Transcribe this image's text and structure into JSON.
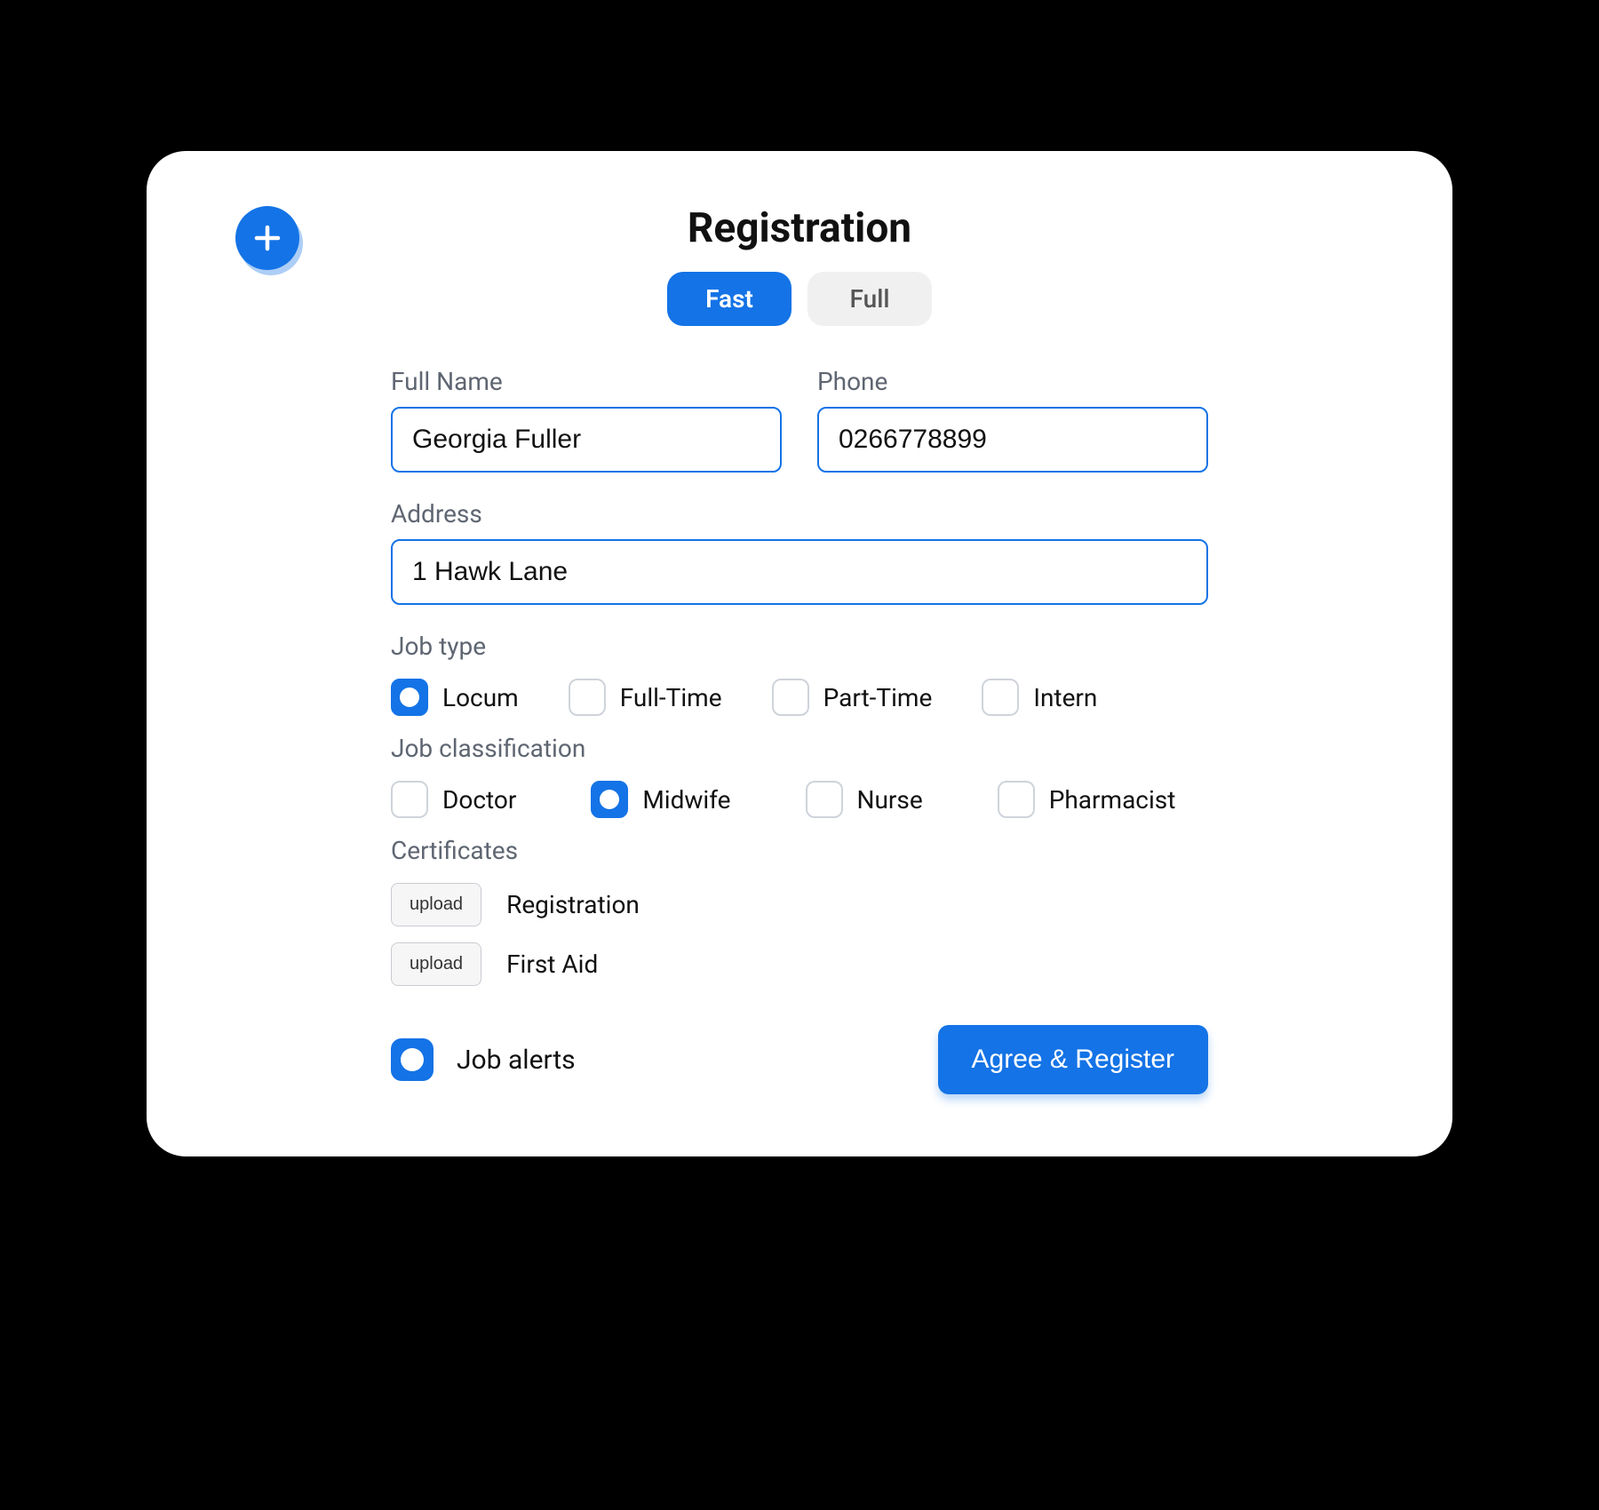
{
  "title": "Registration",
  "tabs": {
    "fast": "Fast",
    "full": "Full"
  },
  "fields": {
    "fullName": {
      "label": "Full Name",
      "value": "Georgia Fuller"
    },
    "phone": {
      "label": "Phone",
      "value": "0266778899"
    },
    "address": {
      "label": "Address",
      "value": "1 Hawk Lane"
    }
  },
  "jobType": {
    "label": "Job type",
    "options": {
      "locum": "Locum",
      "fulltime": "Full-Time",
      "parttime": "Part-Time",
      "intern": "Intern"
    }
  },
  "jobClassification": {
    "label": "Job classification",
    "options": {
      "doctor": "Doctor",
      "midwife": "Midwife",
      "nurse": "Nurse",
      "pharmacist": "Pharmacist"
    }
  },
  "certificates": {
    "label": "Certificates",
    "uploadLabel": "upload",
    "items": {
      "registration": "Registration",
      "firstAid": "First Aid"
    }
  },
  "jobAlertsLabel": "Job alerts",
  "submitLabel": "Agree & Register"
}
